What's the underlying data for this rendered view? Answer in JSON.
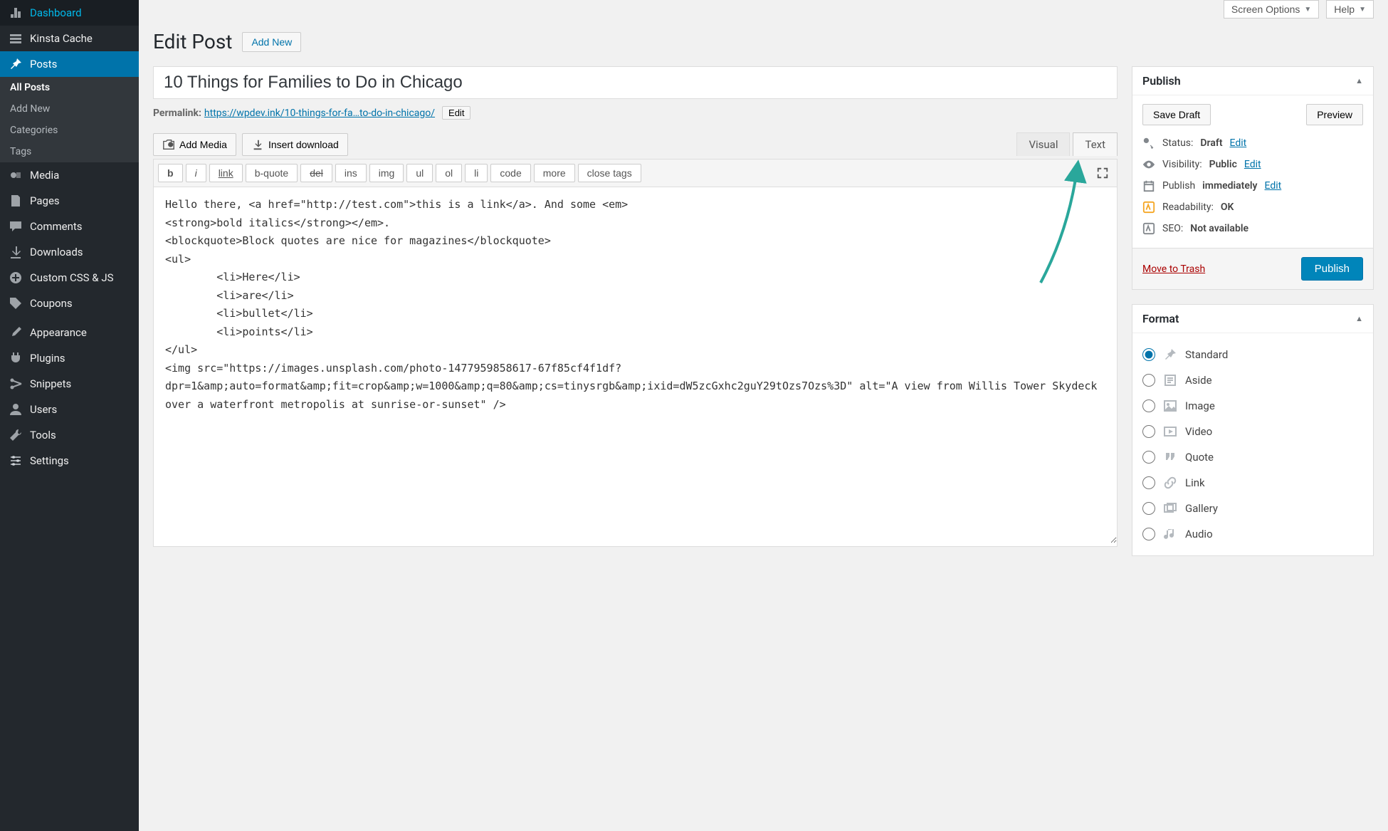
{
  "topbar": {
    "screen_options": "Screen Options",
    "help": "Help"
  },
  "sidebar": {
    "items": [
      {
        "label": "Dashboard"
      },
      {
        "label": "Kinsta Cache"
      },
      {
        "label": "Posts"
      },
      {
        "label": "Media"
      },
      {
        "label": "Pages"
      },
      {
        "label": "Comments"
      },
      {
        "label": "Downloads"
      },
      {
        "label": "Custom CSS & JS"
      },
      {
        "label": "Coupons"
      },
      {
        "label": "Appearance"
      },
      {
        "label": "Plugins"
      },
      {
        "label": "Snippets"
      },
      {
        "label": "Users"
      },
      {
        "label": "Tools"
      },
      {
        "label": "Settings"
      }
    ],
    "posts_submenu": [
      "All Posts",
      "Add New",
      "Categories",
      "Tags"
    ]
  },
  "page": {
    "title": "Edit Post",
    "add_new": "Add New",
    "post_title": "10 Things for Families to Do in Chicago",
    "permalink_label": "Permalink:",
    "permalink_base": "https://wpdev.ink/",
    "permalink_slug": "10-things-for-fa…to-do-in-chicago/",
    "permalink_edit": "Edit"
  },
  "editor": {
    "add_media": "Add Media",
    "insert_download": "Insert download",
    "tabs": {
      "visual": "Visual",
      "text": "Text"
    },
    "quicktags": [
      "b",
      "i",
      "link",
      "b-quote",
      "del",
      "ins",
      "img",
      "ul",
      "ol",
      "li",
      "code",
      "more",
      "close tags"
    ],
    "content": "Hello there, <a href=\"http://test.com\">this is a link</a>. And some <em>\n<strong>bold italics</strong></em>.\n<blockquote>Block quotes are nice for magazines</blockquote>\n<ul>\n        <li>Here</li>\n        <li>are</li>\n        <li>bullet</li>\n        <li>points</li>\n</ul>\n<img src=\"https://images.unsplash.com/photo-1477959858617-67f85cf4f1df?dpr=1&amp;auto=format&amp;fit=crop&amp;w=1000&amp;q=80&amp;cs=tinysrgb&amp;ixid=dW5zcGxhc2guY29tOzs7Ozs%3D\" alt=\"A view from Willis Tower Skydeck over a waterfront metropolis at sunrise-or-sunset\" />"
  },
  "publish": {
    "title": "Publish",
    "save_draft": "Save Draft",
    "preview": "Preview",
    "status_label": "Status:",
    "status_value": "Draft",
    "status_edit": "Edit",
    "visibility_label": "Visibility:",
    "visibility_value": "Public",
    "visibility_edit": "Edit",
    "publish_label": "Publish",
    "publish_value": "immediately",
    "publish_edit": "Edit",
    "readability_label": "Readability:",
    "readability_value": "OK",
    "seo_label": "SEO:",
    "seo_value": "Not available",
    "trash": "Move to Trash",
    "publish_btn": "Publish"
  },
  "format": {
    "title": "Format",
    "items": [
      "Standard",
      "Aside",
      "Image",
      "Video",
      "Quote",
      "Link",
      "Gallery",
      "Audio"
    ]
  }
}
